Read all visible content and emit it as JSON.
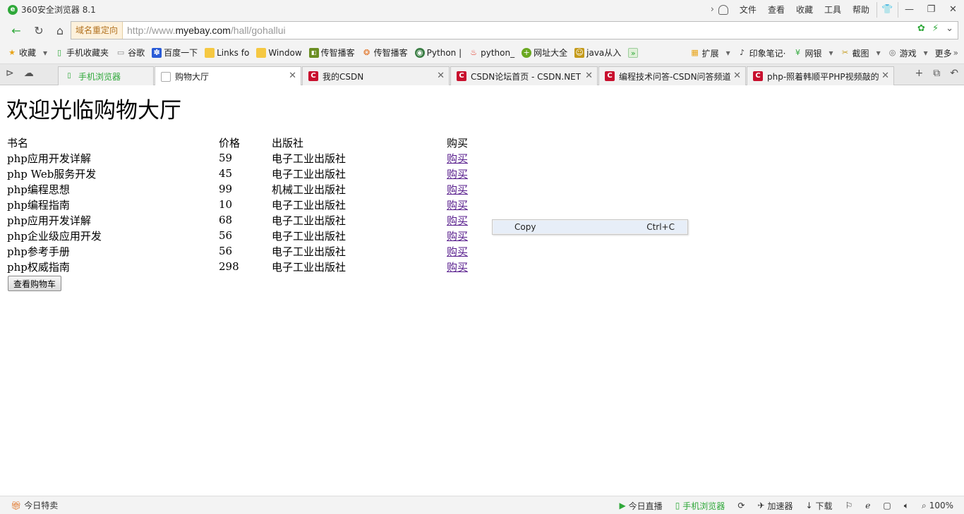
{
  "window": {
    "title": "360安全浏览器 8.1",
    "menu": [
      "文件",
      "查看",
      "收藏",
      "工具",
      "帮助"
    ]
  },
  "address": {
    "redirect_tag": "域名重定向",
    "url_prefix": "http://www.",
    "url_domain": "myebay.com",
    "url_path": "/hall/gohallui"
  },
  "bookmarks": [
    {
      "label": "收藏",
      "icon": "star-icon"
    },
    {
      "label": "手机收藏夹",
      "icon": "phone-icon"
    },
    {
      "label": "谷歌",
      "icon": "page-icon"
    },
    {
      "label": "百度一下",
      "icon": "baidu-icon"
    },
    {
      "label": "Links fo",
      "icon": "folder-icon"
    },
    {
      "label": "Window",
      "icon": "folder-icon"
    },
    {
      "label": "传智播客",
      "icon": "itcast-icon"
    },
    {
      "label": "传智播客",
      "icon": "itcast-icon"
    },
    {
      "label": "Python |",
      "icon": "globe-icon"
    },
    {
      "label": "python_",
      "icon": "fire-icon"
    },
    {
      "label": "网址大全",
      "icon": "plus-icon"
    },
    {
      "label": "java从入",
      "icon": "java-icon"
    }
  ],
  "bookmarks_right": [
    "扩展",
    "印象笔记·",
    "网银",
    "截图",
    "游戏",
    "更多"
  ],
  "tabs": [
    {
      "label": "手机浏览器",
      "icon": "phone-icon",
      "color": "#2fa83a"
    },
    {
      "label": "购物大厅",
      "icon": "page-icon",
      "color": "#888888"
    },
    {
      "label": "我的CSDN",
      "icon": "csdn-icon",
      "color": "#c8102e"
    },
    {
      "label": "CSDN论坛首页 - CSDN.NET",
      "icon": "csdn-icon",
      "color": "#c8102e"
    },
    {
      "label": "编程技术问答-CSDN问答频道",
      "icon": "csdn-icon",
      "color": "#c8102e"
    },
    {
      "label": "php-照着韩顺平PHP视频敲的",
      "icon": "csdn-icon",
      "color": "#c8102e"
    }
  ],
  "page": {
    "title": "欢迎光临购物大厅",
    "headers": [
      "书名",
      "价格",
      "出版社",
      "购买"
    ],
    "books": [
      {
        "name": "php应用开发详解",
        "price": "59",
        "publisher": "电子工业出版社",
        "buy": "购买"
      },
      {
        "name": "php Web服务开发",
        "price": "45",
        "publisher": "电子工业出版社",
        "buy": "购买"
      },
      {
        "name": "php编程思想",
        "price": "99",
        "publisher": "机械工业出版社",
        "buy": "购买"
      },
      {
        "name": "php编程指南",
        "price": "10",
        "publisher": "电子工业出版社",
        "buy": "购买"
      },
      {
        "name": "php应用开发详解",
        "price": "68",
        "publisher": "电子工业出版社",
        "buy": "购买"
      },
      {
        "name": "php企业级应用开发",
        "price": "56",
        "publisher": "电子工业出版社",
        "buy": "购买"
      },
      {
        "name": "php参考手册",
        "price": "56",
        "publisher": "电子工业出版社",
        "buy": "购买"
      },
      {
        "name": "php权威指南",
        "price": "298",
        "publisher": "电子工业出版社",
        "buy": "购买"
      }
    ],
    "cart_button": "查看购物车"
  },
  "context_menu": {
    "label": "Copy",
    "shortcut": "Ctrl+C"
  },
  "status": {
    "left": "今日特卖",
    "live": "今日直播",
    "mobile": "手机浏览器",
    "accelerator": "加速器",
    "download": "下载",
    "zoom": "100%"
  }
}
